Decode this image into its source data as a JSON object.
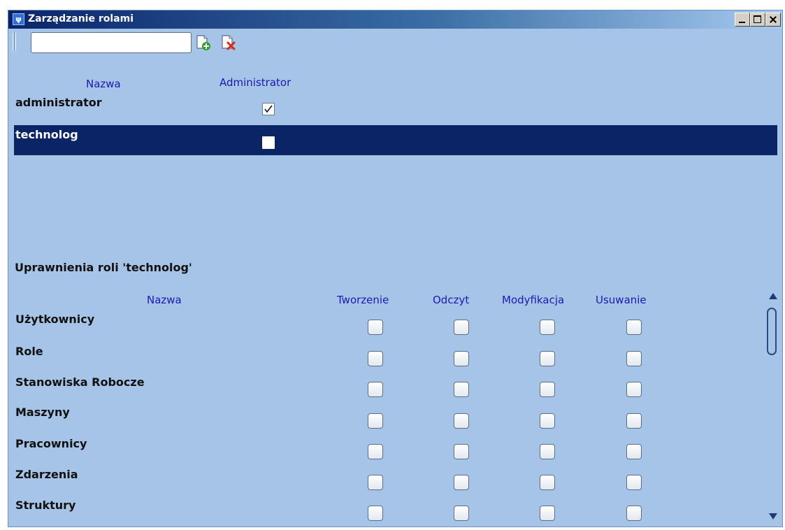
{
  "window": {
    "title": "Zarządzanie rolami"
  },
  "toolbar": {
    "search_value": "",
    "add_icon": "add-document-icon",
    "delete_icon": "delete-document-icon"
  },
  "roles": {
    "headers": {
      "name": "Nazwa",
      "admin": "Administrator"
    },
    "rows": [
      {
        "name": "administrator",
        "admin": true,
        "selected": false
      },
      {
        "name": "technolog",
        "admin": false,
        "selected": true
      }
    ]
  },
  "permissions": {
    "title": "Uprawnienia roli 'technolog'",
    "headers": {
      "name": "Nazwa",
      "create": "Tworzenie",
      "read": "Odczyt",
      "modify": "Modyfikacja",
      "delete": "Usuwanie"
    },
    "rows": [
      {
        "name": "Użytkownicy",
        "create": false,
        "read": false,
        "modify": false,
        "delete": false
      },
      {
        "name": "Role",
        "create": false,
        "read": false,
        "modify": false,
        "delete": false
      },
      {
        "name": "Stanowiska Robocze",
        "create": false,
        "read": false,
        "modify": false,
        "delete": false
      },
      {
        "name": "Maszyny",
        "create": false,
        "read": false,
        "modify": false,
        "delete": false
      },
      {
        "name": "Pracownicy",
        "create": false,
        "read": false,
        "modify": false,
        "delete": false
      },
      {
        "name": "Zdarzenia",
        "create": false,
        "read": false,
        "modify": false,
        "delete": false
      },
      {
        "name": "Struktury",
        "create": false,
        "read": false,
        "modify": false,
        "delete": false
      }
    ]
  },
  "colors": {
    "window_bg": "#a6c4e8",
    "selection": "#0b2466",
    "header_text": "#1a1ab0"
  }
}
